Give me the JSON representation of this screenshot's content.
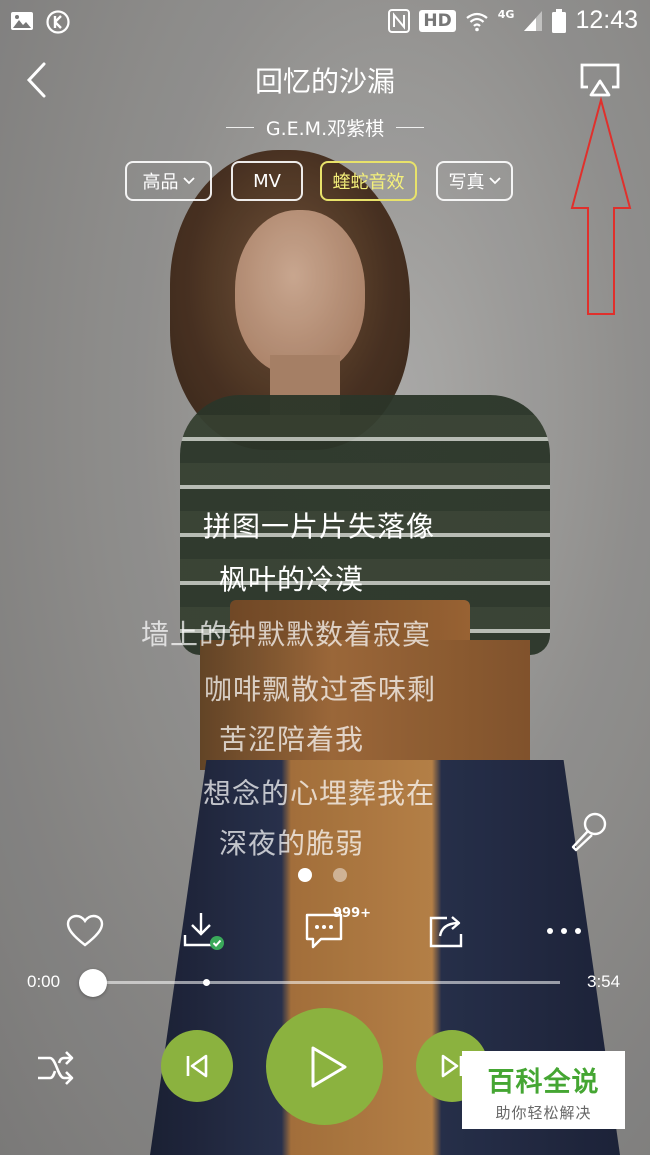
{
  "status_bar": {
    "network": "4G",
    "hd_label": "HD",
    "time": "12:43"
  },
  "header": {
    "song_title": "回忆的沙漏",
    "artist": "G.E.M.邓紫棋"
  },
  "tags": [
    {
      "label": "高品",
      "has_dropdown": true,
      "active": false
    },
    {
      "label": "MV",
      "has_dropdown": false,
      "active": false
    },
    {
      "label": "蝰蛇音效",
      "has_dropdown": false,
      "active": true
    },
    {
      "label": "写真",
      "has_dropdown": true,
      "active": false
    }
  ],
  "lyrics": [
    {
      "text": "拼图一片片失落像",
      "current": true
    },
    {
      "text": "枫叶的冷漠",
      "current": true
    },
    {
      "text": "墙上的钟默默数着寂寞",
      "current": false
    },
    {
      "text": "咖啡飘散过香味剩",
      "current": false
    },
    {
      "text": "苦涩陪着我",
      "current": false
    },
    {
      "text": "想念的心埋葬我在",
      "current": false
    },
    {
      "text": "深夜的脆弱",
      "current": false
    }
  ],
  "page_indicator": {
    "count": 2,
    "active_index": 0
  },
  "actions": {
    "comment_count": "999+",
    "icons": [
      "heart-icon",
      "download-icon",
      "comment-icon",
      "share-icon",
      "more-icon"
    ]
  },
  "progress": {
    "current_time": "0:00",
    "total_time": "3:54",
    "played_fraction": 0.0,
    "buffered_fraction": 0.24
  },
  "controls": {
    "accent_color": "#8bb23f"
  },
  "annotation_color": "#e0302c",
  "watermark": {
    "main": "百科全说",
    "sub": "助你轻松解决"
  }
}
